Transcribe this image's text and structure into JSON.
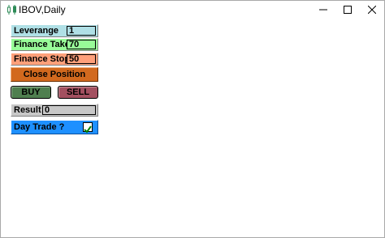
{
  "window": {
    "title": "IBOV,Daily",
    "app_icon": "chart-candles-icon",
    "controls": [
      "minimize-icon",
      "maximize-icon",
      "close-icon"
    ]
  },
  "panel": {
    "leverage": {
      "label": "Leverange",
      "value": "1"
    },
    "finance_take": {
      "label": "Finance Take",
      "value": "70"
    },
    "finance_stop": {
      "label": "Finance Stop",
      "value": "50"
    },
    "close_position": {
      "label": "Close Position"
    },
    "buy": {
      "label": "BUY"
    },
    "sell": {
      "label": "SELL"
    },
    "result": {
      "label": "Result",
      "value": "0"
    },
    "day_trade": {
      "label": "Day Trade ?",
      "checked": true
    }
  },
  "colors": {
    "leverage_bg": "#b0e0e6",
    "take_bg": "#98fb98",
    "stop_bg": "#ffa07a",
    "close_bg": "#d2691e",
    "buy_bg": "#4f7f4f",
    "sell_bg": "#a35060",
    "result_bg": "#c8c8c8",
    "daytrade_bg": "#1e90ff",
    "check_color": "#008000"
  }
}
